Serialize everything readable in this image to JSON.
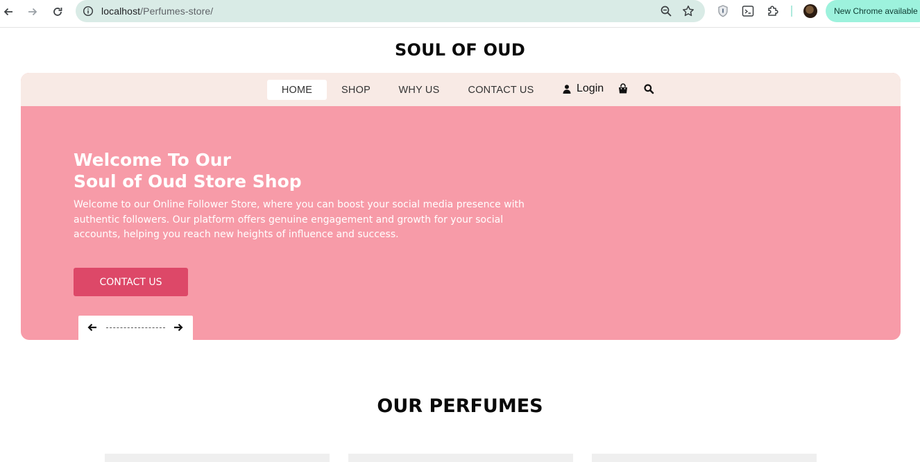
{
  "browser": {
    "url_host": "localhost",
    "url_path": "/Perfumes-store/",
    "update_label": "New Chrome available",
    "icons": [
      "back-icon",
      "forward-icon",
      "reload-icon",
      "site-info-icon",
      "zoom-icon",
      "bookmark-star-icon",
      "shield-extension-icon",
      "terminal-extension-icon",
      "puzzle-extensions-icon",
      "profile-avatar"
    ]
  },
  "site": {
    "title": "SOUL OF OUD",
    "nav": {
      "items": [
        {
          "label": "HOME",
          "active": true
        },
        {
          "label": "SHOP",
          "active": false
        },
        {
          "label": "WHY US",
          "active": false
        },
        {
          "label": "CONTACT US",
          "active": false
        }
      ],
      "login_label": "Login",
      "icons": [
        "user-icon",
        "shopping-bag-icon",
        "search-icon"
      ]
    },
    "hero": {
      "heading_line1": "Welcome To Our",
      "heading_line2": "Soul of Oud Store Shop",
      "text": "Welcome to our Online Follower Store, where you can boost your social media presence with authentic followers. Our platform offers genuine engagement and growth for your social accounts, helping you reach new heights of influence and success.",
      "button_label": "CONTACT US",
      "slider_icons": [
        "arrow-left-icon",
        "arrow-right-icon"
      ]
    },
    "section_title": "OUR PERFUMES"
  },
  "colors": {
    "hero_bg": "#f79ba8",
    "nav_bg": "#f8eae5",
    "button_bg": "#dd4868",
    "omnibox_bg": "#d9ebe6",
    "update_bg": "#9df2dd"
  }
}
